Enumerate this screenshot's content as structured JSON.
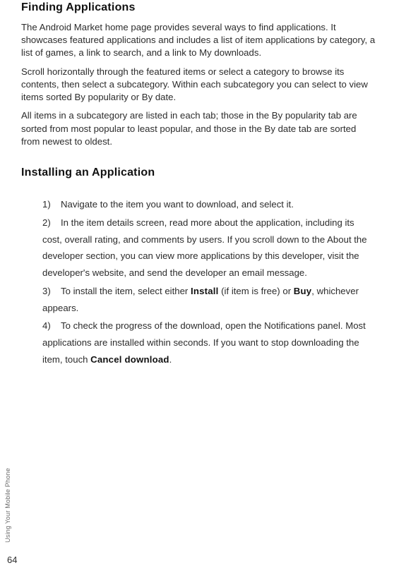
{
  "section1": {
    "heading": "Finding Applications",
    "p1": "The Android Market home page provides several ways to find applications. It showcases featured applications and includes a list of item applications by category, a list of games, a link to search, and a link to My downloads.",
    "p2": "Scroll horizontally through the featured items or select a category to browse its contents, then select a subcategory. Within each subcategory you can select to view items sorted By popularity or By date.",
    "p3": "All items in a subcategory are listed in each tab; those in the By popularity tab are sorted from most popular to least popular, and those in the By date tab are sorted from newest to oldest."
  },
  "section2": {
    "heading": "Installing an Application",
    "step1": {
      "num": "1)",
      "text": "Navigate to the item you want to download, and select it."
    },
    "step2": {
      "num": "2)",
      "text": "In the item details screen, read more about the application, including its cost, overall rating, and comments by users. If you scroll down to the About the developer section, you can view more applications by this developer, visit the developer's website, and send the developer an email message."
    },
    "step3": {
      "num": "3)",
      "pre": "To install the item, select either ",
      "b1": "Install",
      "mid": " (if item is free) or ",
      "b2": "Buy",
      "post": ", whichever appears."
    },
    "step4": {
      "num": "4)",
      "pre": "To check the progress of the download, open the Notifications panel. Most applications are installed within seconds. If you want to stop downloading the item, touch ",
      "b1": "Cancel download",
      "post": "."
    }
  },
  "footer": {
    "side_label": "Using Your Mobile Phone",
    "page_number": "64"
  }
}
